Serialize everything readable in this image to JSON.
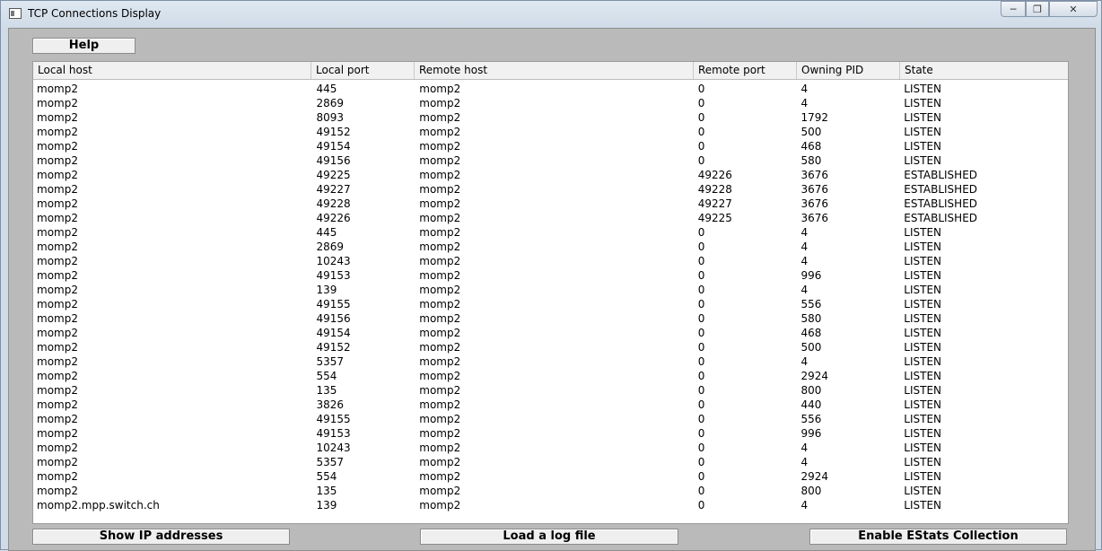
{
  "window": {
    "title": "TCP Connections Display"
  },
  "toolbar": {
    "help_label": "Help"
  },
  "table": {
    "columns": [
      "Local host",
      "Local port",
      "Remote host",
      "Remote port",
      "Owning PID",
      "State"
    ],
    "rows": [
      [
        "momp2",
        "445",
        "momp2",
        "0",
        "4",
        "LISTEN"
      ],
      [
        "momp2",
        "2869",
        "momp2",
        "0",
        "4",
        "LISTEN"
      ],
      [
        "momp2",
        "8093",
        "momp2",
        "0",
        "1792",
        "LISTEN"
      ],
      [
        "momp2",
        "49152",
        "momp2",
        "0",
        "500",
        "LISTEN"
      ],
      [
        "momp2",
        "49154",
        "momp2",
        "0",
        "468",
        "LISTEN"
      ],
      [
        "momp2",
        "49156",
        "momp2",
        "0",
        "580",
        "LISTEN"
      ],
      [
        "momp2",
        "49225",
        "momp2",
        "49226",
        "3676",
        "ESTABLISHED"
      ],
      [
        "momp2",
        "49227",
        "momp2",
        "49228",
        "3676",
        "ESTABLISHED"
      ],
      [
        "momp2",
        "49228",
        "momp2",
        "49227",
        "3676",
        "ESTABLISHED"
      ],
      [
        "momp2",
        "49226",
        "momp2",
        "49225",
        "3676",
        "ESTABLISHED"
      ],
      [
        "momp2",
        "445",
        "momp2",
        "0",
        "4",
        "LISTEN"
      ],
      [
        "momp2",
        "2869",
        "momp2",
        "0",
        "4",
        "LISTEN"
      ],
      [
        "momp2",
        "10243",
        "momp2",
        "0",
        "4",
        "LISTEN"
      ],
      [
        "momp2",
        "49153",
        "momp2",
        "0",
        "996",
        "LISTEN"
      ],
      [
        "momp2",
        "139",
        "momp2",
        "0",
        "4",
        "LISTEN"
      ],
      [
        "momp2",
        "49155",
        "momp2",
        "0",
        "556",
        "LISTEN"
      ],
      [
        "momp2",
        "49156",
        "momp2",
        "0",
        "580",
        "LISTEN"
      ],
      [
        "momp2",
        "49154",
        "momp2",
        "0",
        "468",
        "LISTEN"
      ],
      [
        "momp2",
        "49152",
        "momp2",
        "0",
        "500",
        "LISTEN"
      ],
      [
        "momp2",
        "5357",
        "momp2",
        "0",
        "4",
        "LISTEN"
      ],
      [
        "momp2",
        "554",
        "momp2",
        "0",
        "2924",
        "LISTEN"
      ],
      [
        "momp2",
        "135",
        "momp2",
        "0",
        "800",
        "LISTEN"
      ],
      [
        "momp2",
        "3826",
        "momp2",
        "0",
        "440",
        "LISTEN"
      ],
      [
        "momp2",
        "49155",
        "momp2",
        "0",
        "556",
        "LISTEN"
      ],
      [
        "momp2",
        "49153",
        "momp2",
        "0",
        "996",
        "LISTEN"
      ],
      [
        "momp2",
        "10243",
        "momp2",
        "0",
        "4",
        "LISTEN"
      ],
      [
        "momp2",
        "5357",
        "momp2",
        "0",
        "4",
        "LISTEN"
      ],
      [
        "momp2",
        "554",
        "momp2",
        "0",
        "2924",
        "LISTEN"
      ],
      [
        "momp2",
        "135",
        "momp2",
        "0",
        "800",
        "LISTEN"
      ],
      [
        "momp2.mpp.switch.ch",
        "139",
        "momp2",
        "0",
        "4",
        "LISTEN"
      ]
    ]
  },
  "bottom_bar": {
    "show_ip_label": "Show IP addresses",
    "load_log_label": "Load a log file",
    "enable_estats_label": "Enable EStats Collection"
  },
  "icons": {
    "app": "app-window-icon",
    "minimize": "minimize-icon",
    "maximize": "maximize-icon",
    "close": "close-icon"
  }
}
